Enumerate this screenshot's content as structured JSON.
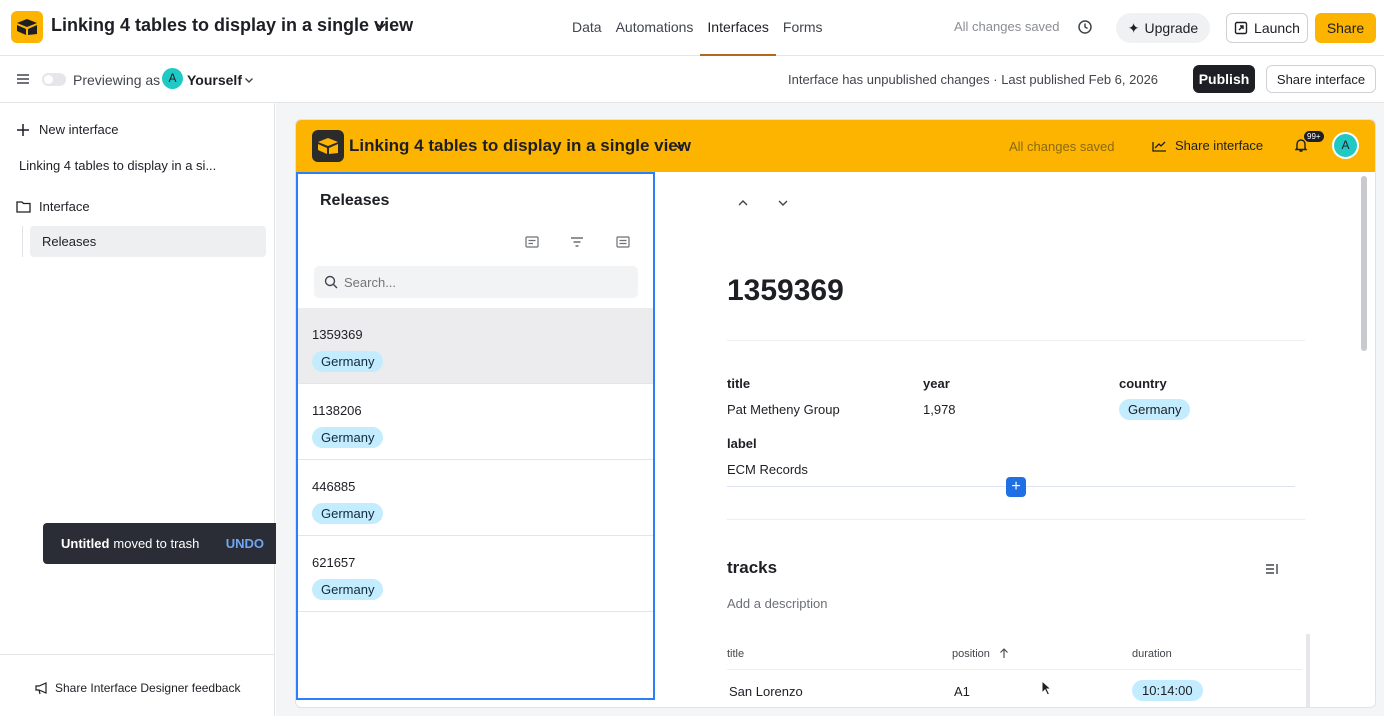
{
  "topbar": {
    "base_title": "Linking 4 tables to display in a single view",
    "nav": [
      "Data",
      "Automations",
      "Interfaces",
      "Forms"
    ],
    "active_nav": "Interfaces",
    "saved_status": "All changes saved",
    "upgrade_label": "Upgrade",
    "launch_label": "Launch",
    "share_label": "Share"
  },
  "subbar": {
    "preview_label": "Previewing as",
    "avatar_initial": "A",
    "user_label": "Yourself",
    "publish_status": "Interface has unpublished changes · Last published Feb 6, 2026",
    "publish_label": "Publish",
    "share_interface_label": "Share interface"
  },
  "sidebar": {
    "new_interface_label": "New interface",
    "base_name": "Linking 4 tables to display in a si...",
    "folder_label": "Interface",
    "page_label": "Releases",
    "feedback_label": "Share Interface Designer feedback"
  },
  "toast": {
    "bold": "Untitled",
    "text": "moved to trash",
    "action": "UNDO"
  },
  "interface": {
    "title": "Linking 4 tables to display in a single view",
    "saved_status": "All changes saved",
    "share_label": "Share interface",
    "notification_badge": "99+",
    "avatar_initial": "A",
    "accent_color": "#fcb400"
  },
  "list": {
    "title": "Releases",
    "search_placeholder": "Search...",
    "records": [
      {
        "id": "1359369",
        "country": "Germany"
      },
      {
        "id": "1138206",
        "country": "Germany"
      },
      {
        "id": "446885",
        "country": "Germany"
      },
      {
        "id": "621657",
        "country": "Germany"
      }
    ]
  },
  "detail": {
    "heading": "1359369",
    "fields": {
      "title_label": "title",
      "title_value": "Pat Metheny Group",
      "year_label": "year",
      "year_value": "1,978",
      "country_label": "country",
      "country_value": "Germany",
      "label_label": "label",
      "label_value": "ECM Records"
    },
    "add_label": "+",
    "tracks": {
      "heading": "tracks",
      "description": "Add a description",
      "columns": [
        "title",
        "position",
        "duration"
      ],
      "rows": [
        {
          "title": "San Lorenzo",
          "position": "A1",
          "duration": "10:14:00"
        }
      ]
    }
  }
}
